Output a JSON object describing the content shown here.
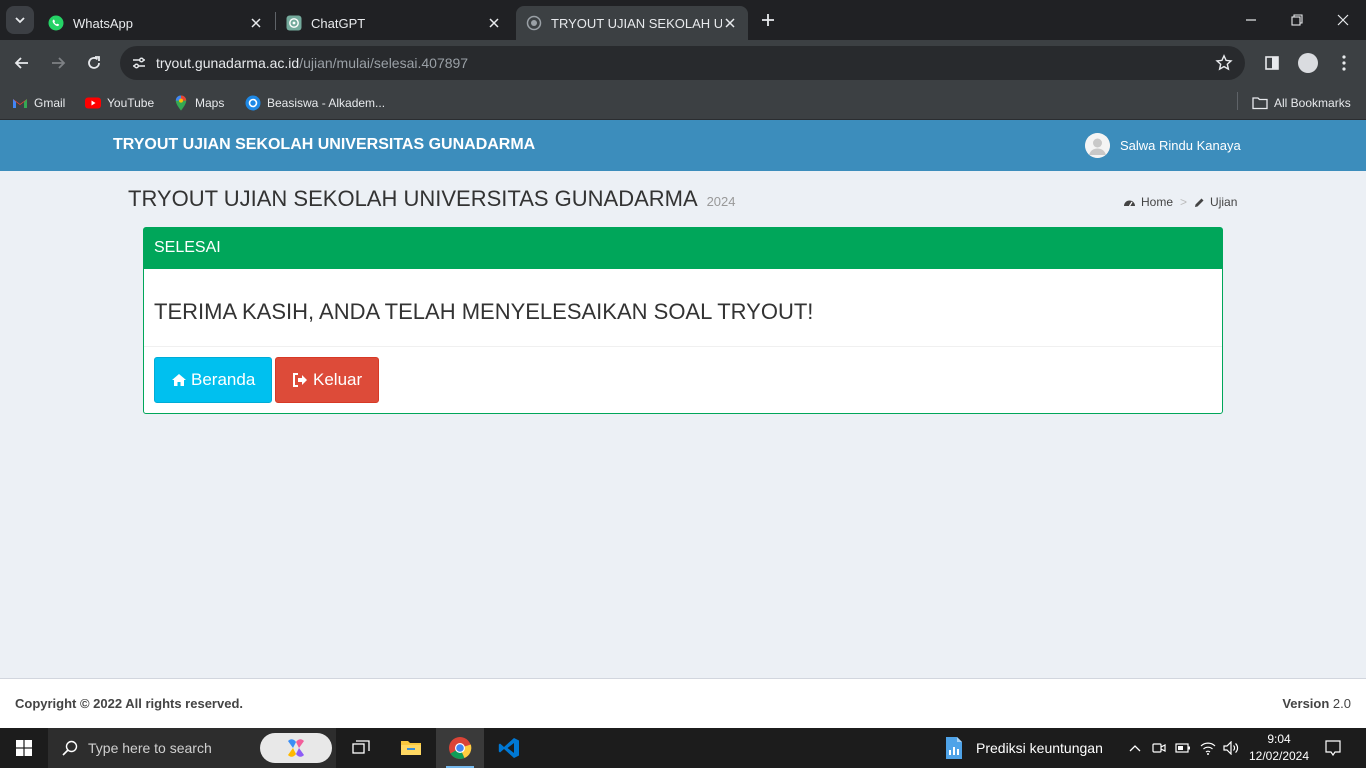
{
  "browser": {
    "tabs": [
      {
        "title": "WhatsApp",
        "icon": "whatsapp-icon"
      },
      {
        "title": "ChatGPT",
        "icon": "chatgpt-icon"
      },
      {
        "title": "TRYOUT UJIAN SEKOLAH UNIVE",
        "icon": "globe-icon",
        "active": true
      }
    ],
    "address": {
      "host": "tryout.gunadarma.ac.id",
      "path": "/ujian/mulai/selesai.407897"
    },
    "bookmarks": [
      {
        "label": "Gmail",
        "icon": "gmail-icon"
      },
      {
        "label": "YouTube",
        "icon": "youtube-icon"
      },
      {
        "label": "Maps",
        "icon": "maps-icon"
      },
      {
        "label": "Beasiswa - Alkadem...",
        "icon": "beasiswa-icon"
      }
    ],
    "all_bookmarks": "All Bookmarks"
  },
  "header": {
    "brand": "TRYOUT UJIAN SEKOLAH UNIVERSITAS GUNADARMA",
    "user_name": "Salwa Rindu Kanaya"
  },
  "content": {
    "title": "TRYOUT UJIAN SEKOLAH UNIVERSITAS GUNADARMA",
    "year": "2024",
    "breadcrumb": [
      "Home",
      ">",
      "Ujian"
    ]
  },
  "box": {
    "header": "SELESAI",
    "message": "TERIMA KASIH, ANDA TELAH MENYELESAIKAN SOAL TRYOUT!",
    "buttons": {
      "home": "Beranda",
      "logout": "Keluar"
    }
  },
  "footer": {
    "copyright": "Copyright © 2022 All rights reserved.",
    "version_label": "Version",
    "version_value": "2.0"
  },
  "taskbar": {
    "search_placeholder": "Type here to search",
    "widget_text": "Prediksi keuntungan",
    "time": "9:04",
    "date": "12/02/2024"
  },
  "colors": {
    "header_blue": "#3c8dbc",
    "success_green": "#00a65a",
    "info_cyan": "#00c0ef",
    "danger_red": "#dd4b39"
  }
}
